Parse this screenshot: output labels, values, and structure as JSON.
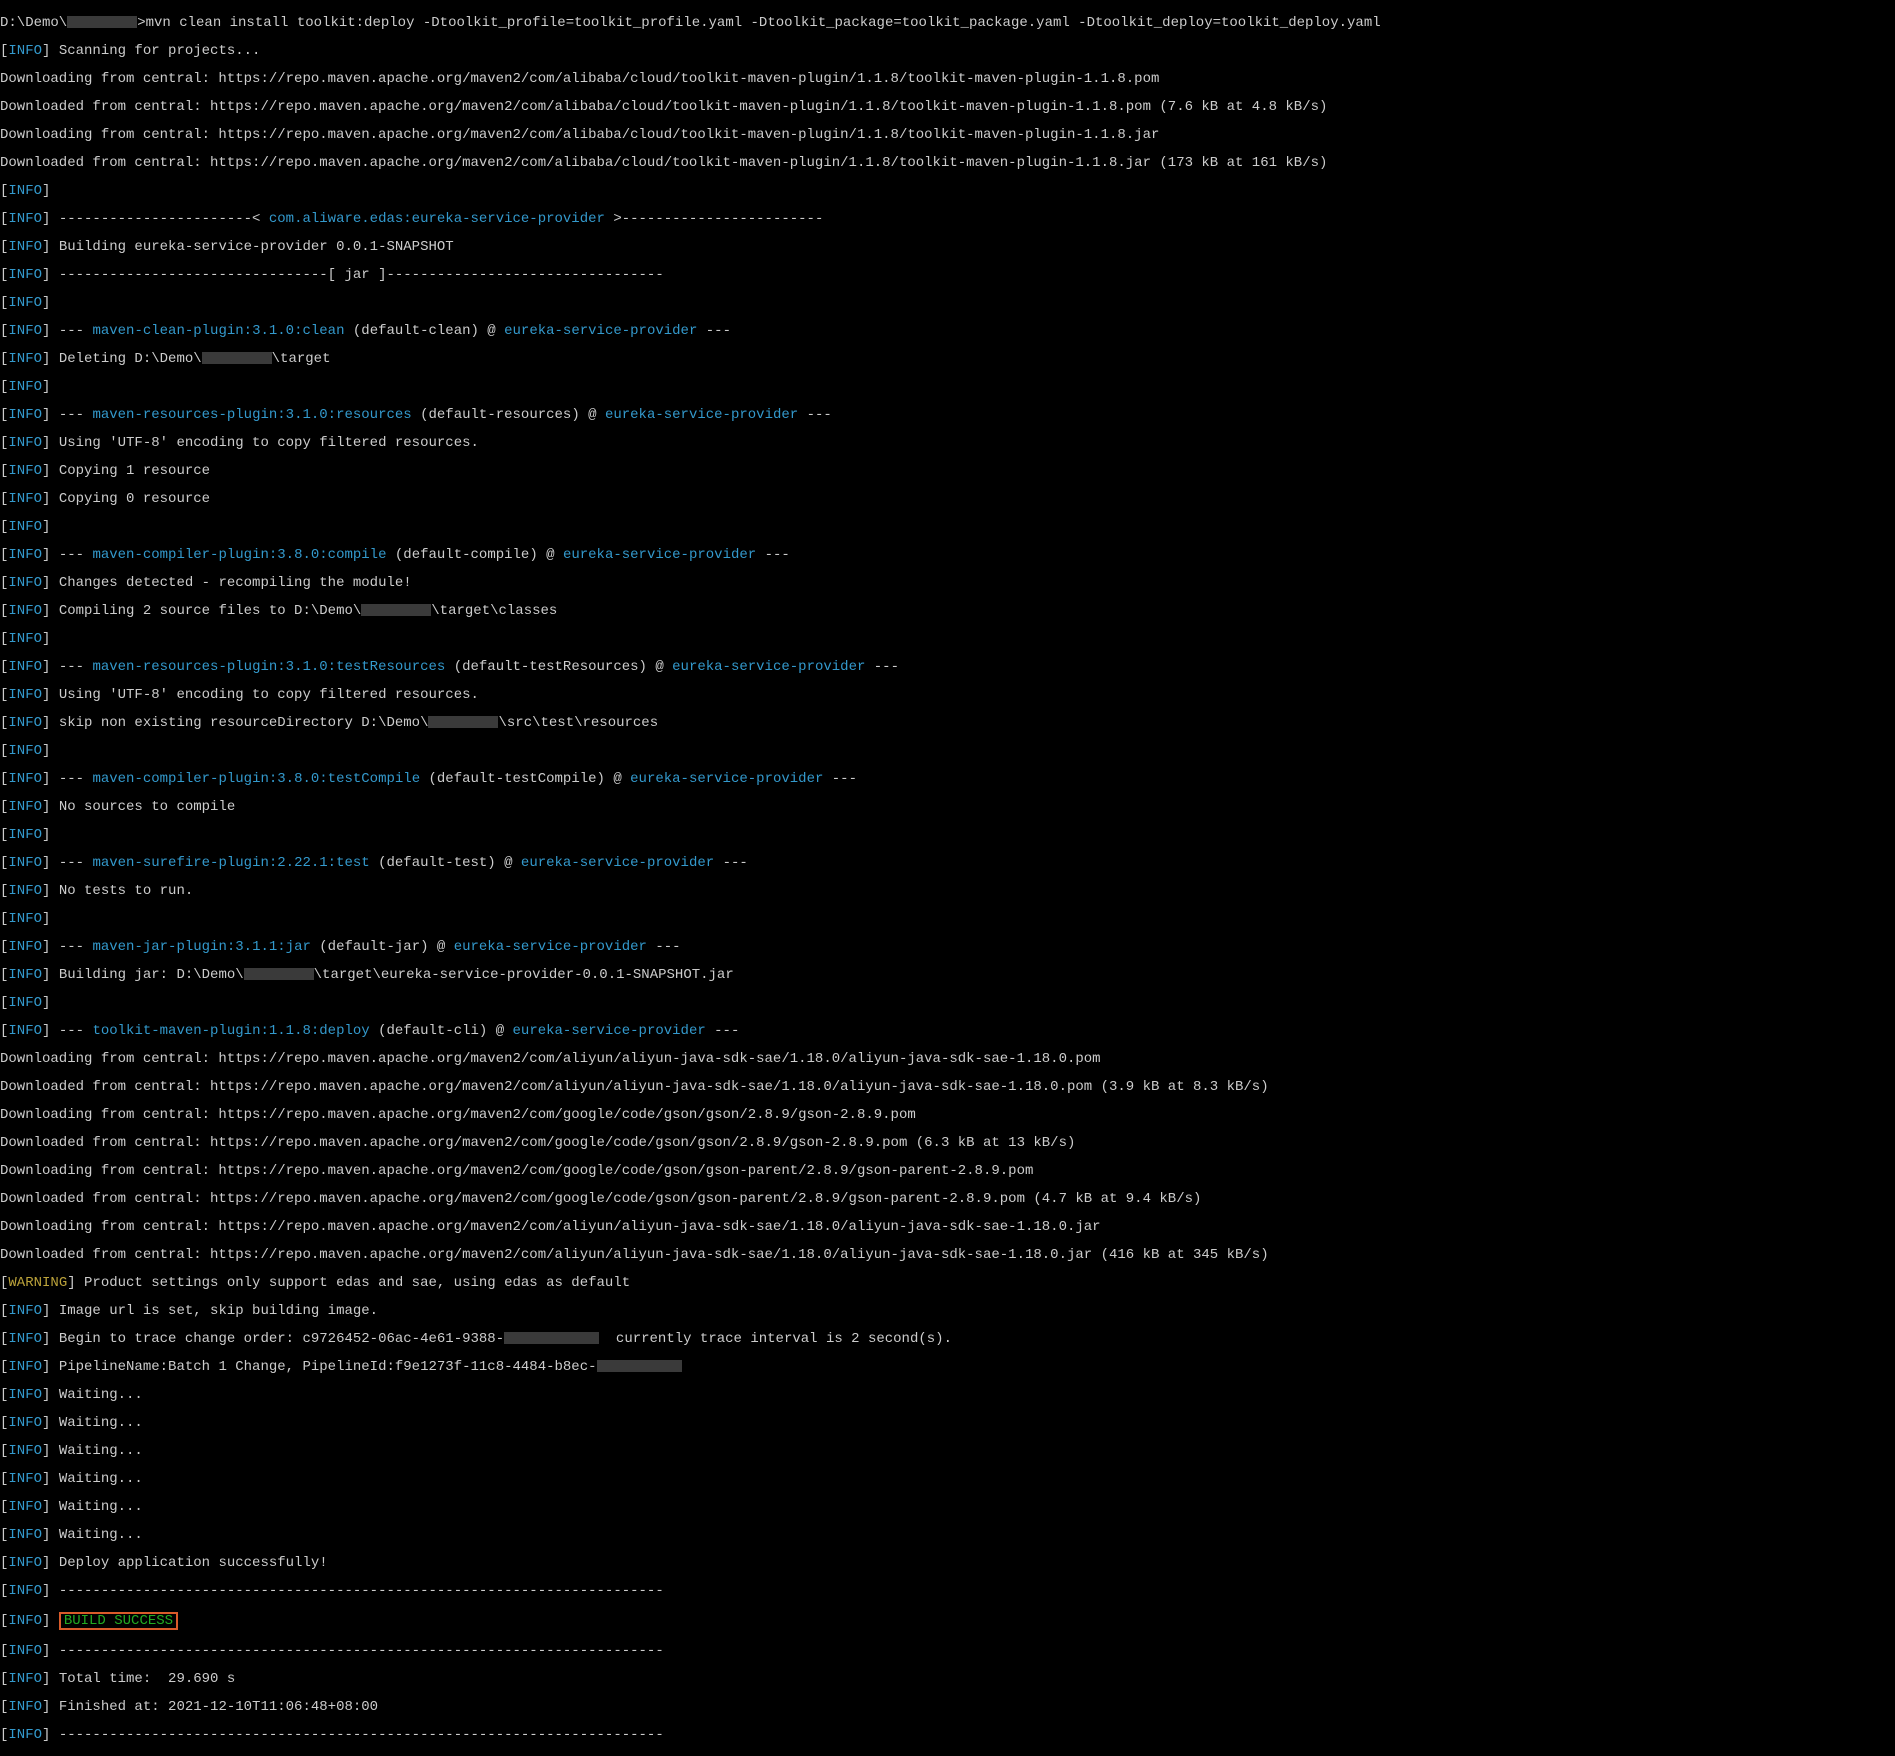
{
  "colors": {
    "info": "#3399cc",
    "warning": "#bba23a",
    "success": "#22aa22",
    "highlight_border": "#d95b2a",
    "text": "#cccccc",
    "bg": "#000000"
  },
  "prompt_prefix": "D:\\Demo\\",
  "prompt_cmd": ">mvn clean install toolkit:deploy -Dtoolkit_profile=toolkit_profile.yaml -Dtoolkit_package=toolkit_package.yaml -Dtoolkit_deploy=toolkit_deploy.yaml",
  "l_scan": " Scanning for projects...",
  "dl_pom": "Downloading from central: https://repo.maven.apache.org/maven2/com/alibaba/cloud/toolkit-maven-plugin/1.1.8/toolkit-maven-plugin-1.1.8.pom",
  "dd_pom": "Downloaded from central: https://repo.maven.apache.org/maven2/com/alibaba/cloud/toolkit-maven-plugin/1.1.8/toolkit-maven-plugin-1.1.8.pom (7.6 kB at 4.8 kB/s)",
  "dl_jar": "Downloading from central: https://repo.maven.apache.org/maven2/com/alibaba/cloud/toolkit-maven-plugin/1.1.8/toolkit-maven-plugin-1.1.8.jar",
  "dd_jar": "Downloaded from central: https://repo.maven.apache.org/maven2/com/alibaba/cloud/toolkit-maven-plugin/1.1.8/toolkit-maven-plugin-1.1.8.jar (173 kB at 161 kB/s)",
  "hdr_open": " -----------------------< ",
  "hdr_link": "com.aliware.edas:eureka-service-provider",
  "hdr_close": " >------------------------",
  "building": " Building eureka-service-provider 0.0.1-SNAPSHOT",
  "jarline": " --------------------------------[ jar ]---------------------------------",
  "d3": "---",
  "clean_pfx": " --- ",
  "p_clean": "maven-clean-plugin:3.1.0:clean",
  "clean_sfx": " (default-clean) @ ",
  "esp": "eureka-service-provider",
  "deleting": " Deleting D:\\Demo\\",
  "deleting2": "\\target",
  "p_res": "maven-resources-plugin:3.1.0:resources",
  "res_sfx": " (default-resources) @ ",
  "enc": " Using 'UTF-8' encoding to copy filtered resources.",
  "copy1": " Copying 1 resource",
  "copy0": " Copying 0 resource",
  "p_comp": "maven-compiler-plugin:3.8.0:compile",
  "comp_sfx": " (default-compile) @ ",
  "changes": " Changes detected - recompiling the module!",
  "compiling": " Compiling 2 source files to D:\\Demo\\",
  "compiling2": "\\target\\classes",
  "p_tres": "maven-resources-plugin:3.1.0:testResources",
  "tres_sfx": " (default-testResources) @ ",
  "skipres": " skip non existing resourceDirectory D:\\Demo\\",
  "skipres2": "\\src\\test\\resources",
  "p_tcomp": "maven-compiler-plugin:3.8.0:testCompile",
  "tcomp_sfx": " (default-testCompile) @ ",
  "nosrc": " No sources to compile",
  "p_sure": "maven-surefire-plugin:2.22.1:test",
  "sure_sfx": " (default-test) @ ",
  "notest": " No tests to run.",
  "p_jar": "maven-jar-plugin:3.1.1:jar",
  "jar_sfx": " (default-jar) @ ",
  "bjar": " Building jar: D:\\Demo\\",
  "bjar2": "\\target\\eureka-service-provider-0.0.1-SNAPSHOT.jar",
  "p_toolkit": "toolkit-maven-plugin:1.1.8:deploy",
  "tk_sfx": " (default-cli) @ ",
  "dl_sae_pom": "Downloading from central: https://repo.maven.apache.org/maven2/com/aliyun/aliyun-java-sdk-sae/1.18.0/aliyun-java-sdk-sae-1.18.0.pom",
  "dd_sae_pom": "Downloaded from central: https://repo.maven.apache.org/maven2/com/aliyun/aliyun-java-sdk-sae/1.18.0/aliyun-java-sdk-sae-1.18.0.pom (3.9 kB at 8.3 kB/s)",
  "dl_gson_pom": "Downloading from central: https://repo.maven.apache.org/maven2/com/google/code/gson/gson/2.8.9/gson-2.8.9.pom",
  "dd_gson_pom": "Downloaded from central: https://repo.maven.apache.org/maven2/com/google/code/gson/gson/2.8.9/gson-2.8.9.pom (6.3 kB at 13 kB/s)",
  "dl_gsonp": "Downloading from central: https://repo.maven.apache.org/maven2/com/google/code/gson/gson-parent/2.8.9/gson-parent-2.8.9.pom",
  "dd_gsonp": "Downloaded from central: https://repo.maven.apache.org/maven2/com/google/code/gson/gson-parent/2.8.9/gson-parent-2.8.9.pom (4.7 kB at 9.4 kB/s)",
  "dl_sae_jar": "Downloading from central: https://repo.maven.apache.org/maven2/com/aliyun/aliyun-java-sdk-sae/1.18.0/aliyun-java-sdk-sae-1.18.0.jar",
  "dd_sae_jar": "Downloaded from central: https://repo.maven.apache.org/maven2/com/aliyun/aliyun-java-sdk-sae/1.18.0/aliyun-java-sdk-sae-1.18.0.jar (416 kB at 345 kB/s)",
  "warn_msg": " Product settings only support edas and sae, using edas as default",
  "img_url": " Image url is set, skip building image.",
  "trace_a": " Begin to trace change order: c9726452-06ac-4e61-9388-",
  "trace_b": "  currently trace interval is 2 second(s).",
  "pipe_a": " PipelineName:Batch 1 Change, PipelineId:f9e1273f-11c8-4484-b8ec-",
  "waiting": " Waiting...",
  "deploy_ok": " Deploy application successfully!",
  "rule": " ------------------------------------------------------------------------",
  "build": "BUILD SUCCESS",
  "time": " Total time:  29.690 s",
  "finished": " Finished at: 2021-12-10T11:06:48+08:00",
  "INFO": "INFO",
  "WARNING": "WARNING"
}
